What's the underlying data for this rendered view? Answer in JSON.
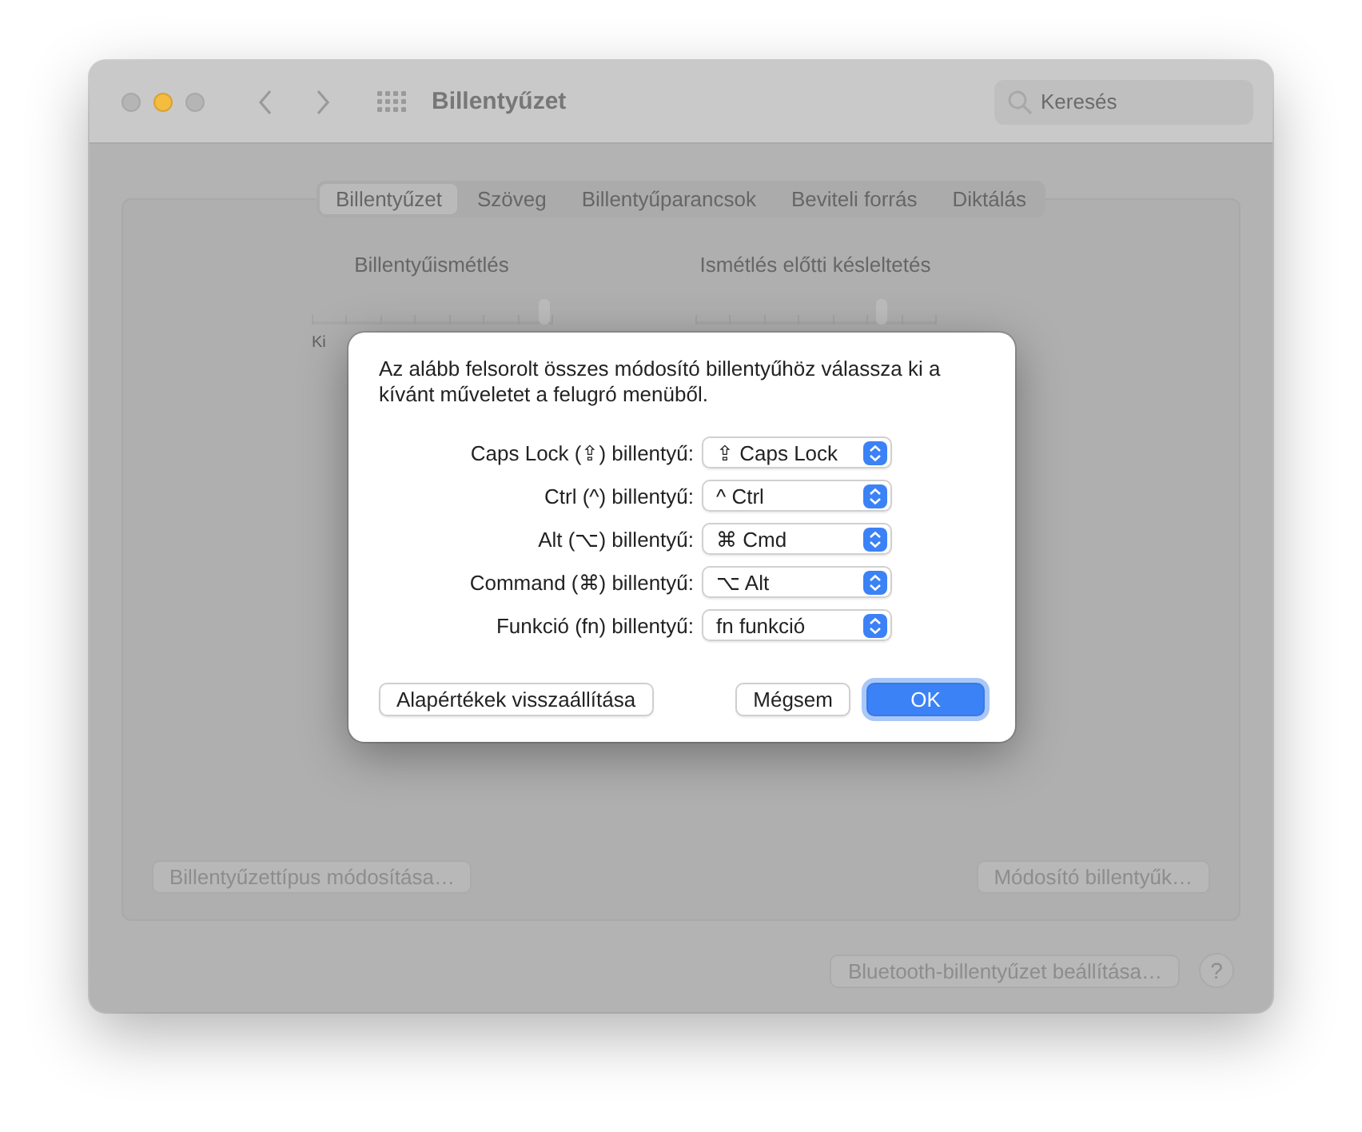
{
  "window": {
    "title": "Billentyűzet",
    "search": {
      "placeholder": "Keresés"
    }
  },
  "tabs": [
    {
      "label": "Billentyűzet",
      "selected": true
    },
    {
      "label": "Szöveg",
      "selected": false
    },
    {
      "label": "Billentyűparancsok",
      "selected": false
    },
    {
      "label": "Beviteli forrás",
      "selected": false
    },
    {
      "label": "Diktálás",
      "selected": false
    }
  ],
  "sliders": [
    {
      "label": "Billentyűismétlés",
      "level": 0.97,
      "min_label": "Ki"
    },
    {
      "label": "Ismétlés előtti késleltetés",
      "level": 0.78
    }
  ],
  "panel_buttons": [
    "Billentyűzettípus módosítása…",
    "Módosító billentyűk…"
  ],
  "footer": {
    "button": "Bluetooth-billentyűzet beállítása…",
    "help": "?"
  },
  "dialog": {
    "message": "Az alább felsorolt összes módosító billentyűhöz válassza ki a kívánt műveletet a felugró menüből.",
    "rows": [
      {
        "label": "Caps Lock (⇪) billentyű:",
        "value": "⇪ Caps Lock"
      },
      {
        "label": "Ctrl (^) billentyű:",
        "value": "^ Ctrl"
      },
      {
        "label": "Alt (⌥) billentyű:",
        "value": "⌘ Cmd"
      },
      {
        "label": "Command (⌘) billentyű:",
        "value": "⌥ Alt"
      },
      {
        "label": "Funkció (fn) billentyű:",
        "value": "fn funkció"
      }
    ],
    "reset_button": "Alapértékek visszaállítása",
    "cancel_button": "Mégsem",
    "ok_button": "OK"
  }
}
